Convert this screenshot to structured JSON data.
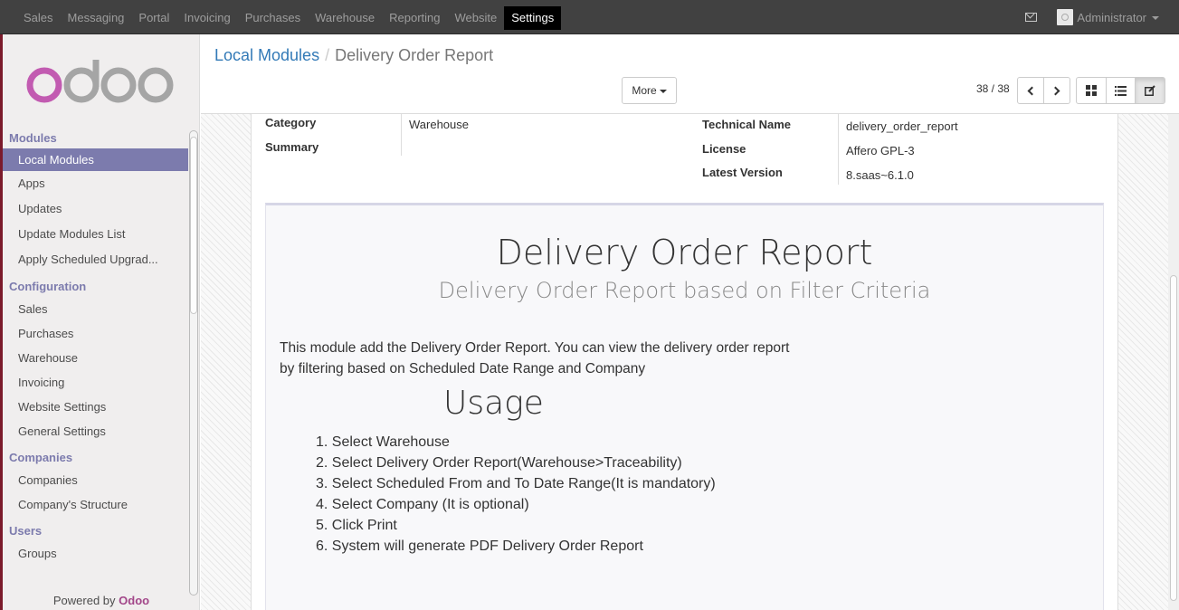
{
  "topnav": {
    "items": [
      "Sales",
      "Messaging",
      "Portal",
      "Invoicing",
      "Purchases",
      "Warehouse",
      "Reporting",
      "Website",
      "Settings"
    ],
    "active": "Settings",
    "user": "Administrator"
  },
  "sidebar": {
    "sections": [
      {
        "title": "Modules",
        "items": [
          "Local Modules",
          "Apps",
          "Updates",
          "Update Modules List",
          "Apply Scheduled Upgrad..."
        ]
      },
      {
        "title": "Configuration",
        "items": [
          "Sales",
          "Purchases",
          "Warehouse",
          "Invoicing",
          "Website Settings",
          "General Settings"
        ]
      },
      {
        "title": "Companies",
        "items": [
          "Companies",
          "Company's Structure"
        ]
      },
      {
        "title": "Users",
        "items": [
          "Groups"
        ]
      }
    ],
    "active_item": "Local Modules",
    "powered_prefix": "Powered by",
    "powered_brand": "Odoo"
  },
  "control": {
    "breadcrumb_parent": "Local Modules",
    "breadcrumb_current": "Delivery Order Report",
    "more_label": "More",
    "pager": "38 / 38"
  },
  "record": {
    "category_label": "Category",
    "category_value": "Warehouse",
    "summary_label": "Summary",
    "summary_value": "",
    "technical_name_label": "Technical Name",
    "technical_name_value": "delivery_order_report",
    "license_label": "License",
    "license_value": "Affero GPL-3",
    "latest_version_label": "Latest Version",
    "latest_version_value": "8.saas~6.1.0"
  },
  "description": {
    "title": "Delivery Order Report",
    "subtitle": "Delivery Order Report based on Filter Criteria",
    "para_line1": "This module add the Delivery Order Report. You can view the delivery order report",
    "para_line2": "by filtering based on Scheduled Date Range and Company",
    "usage": "Usage",
    "steps": [
      "1. Select Warehouse",
      "2. Select Delivery Order Report(Warehouse>Traceability)",
      "3. Select Scheduled From and To Date Range(It is mandatory)",
      "4. Select Company (It is optional)",
      "5. Click Print",
      "6. System will generate PDF Delivery Order Report"
    ]
  },
  "colors": {
    "topbar": "#414141",
    "sidebar_accent": "#7c7bad",
    "link": "#337ab7",
    "brand": "#a24689"
  }
}
